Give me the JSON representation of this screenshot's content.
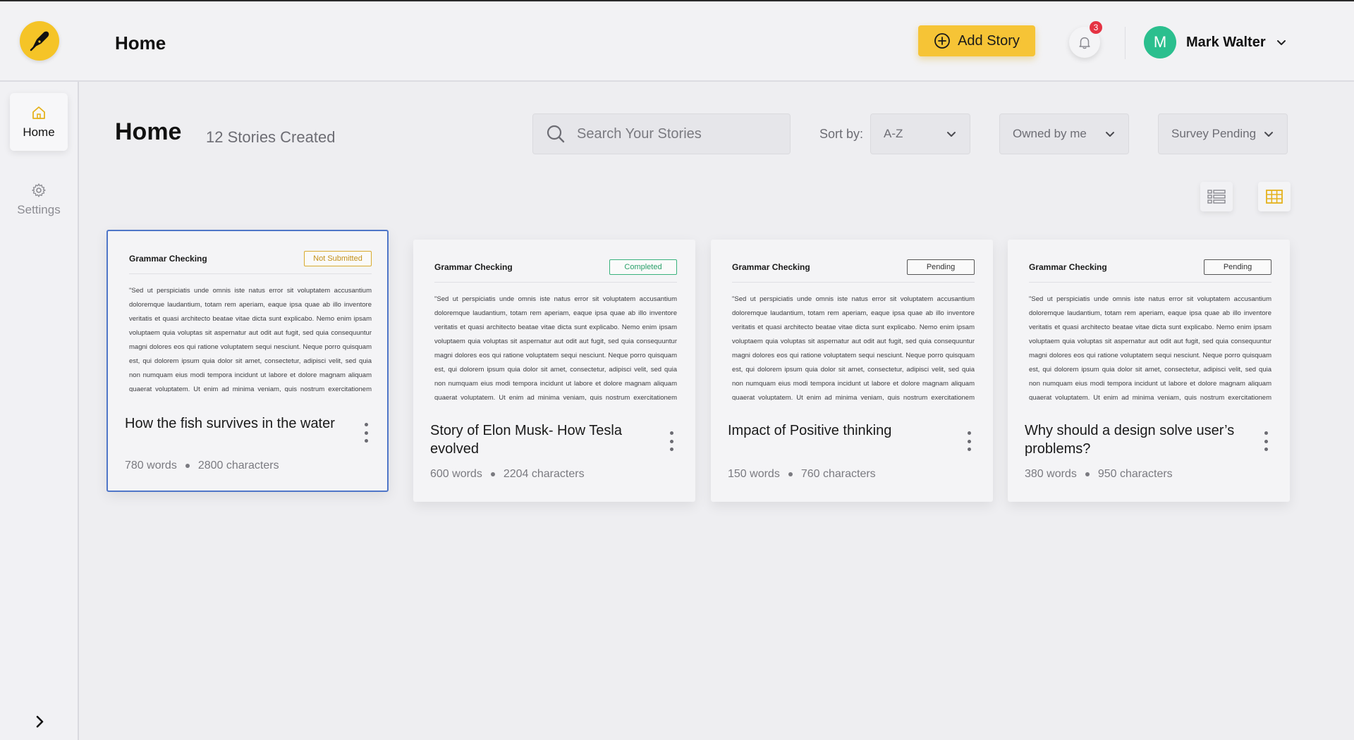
{
  "header": {
    "title": "Home",
    "add_story_label": "Add Story",
    "notification_count": "3",
    "user": {
      "initial": "M",
      "name": "Mark Walter"
    }
  },
  "sidebar": {
    "items": [
      {
        "label": "Home",
        "icon": "home-icon",
        "active": true
      },
      {
        "label": "Settings",
        "icon": "gear-icon",
        "active": false
      }
    ]
  },
  "main": {
    "title": "Home",
    "stories_count": "12 Stories Created",
    "search": {
      "placeholder": "Search Your Stories"
    },
    "sort_label": "Sort by:",
    "sort_value": "A-Z",
    "owner_filter": "Owned by me",
    "status_filter": "Survey Pending"
  },
  "colors": {
    "accent": "#f6c436",
    "selected_border": "#4f76c8",
    "completed": "#2aa06a",
    "not_submitted": "#c39017",
    "badge": "#e53343",
    "avatar": "#2bbf8e"
  },
  "stories": [
    {
      "doc_title": "Grammar Checking",
      "status": "Not Submitted",
      "body": "\"Sed ut perspiciatis unde omnis iste natus error sit voluptatem accusantium doloremque laudantium, totam rem aperiam, eaque ipsa quae ab illo inventore veritatis et quasi architecto beatae vitae dicta sunt explicabo. Nemo enim ipsam voluptaem quia voluptas sit aspernatur aut odit aut fugit, sed quia consequuntur magni dolores eos qui ratione voluptatem sequi nesciunt. Neque porro quisquam est, qui dolorem ipsum quia dolor sit amet, consectetur, adipisci velit, sed quia non numquam eius modi tempora incidunt ut labore et dolore magnam aliquam quaerat voluptatem. Ut enim ad minima veniam, quis nostrum exercitationem ullam",
      "title": "How the fish survives in the water",
      "words": "780 words",
      "characters": "2800 characters"
    },
    {
      "doc_title": "Grammar Checking",
      "status": "Completed",
      "body": "\"Sed ut perspiciatis unde omnis iste natus error sit voluptatem accusantium doloremque laudantium, totam rem aperiam, eaque ipsa quae ab illo inventore veritatis et quasi architecto beatae vitae dicta sunt explicabo. Nemo enim ipsam voluptaem quia voluptas sit aspernatur aut odit aut fugit, sed quia consequuntur magni dolores eos qui ratione voluptatem sequi nesciunt. Neque porro quisquam est, qui dolorem ipsum quia dolor sit amet, consectetur, adipisci velit, sed quia non numquam eius modi tempora incidunt ut labore et dolore magnam aliquam quaerat voluptatem. Ut enim ad minima veniam, quis nostrum exercitationem ullam",
      "title": "Story of Elon Musk- How Tesla evolved",
      "words": "600 words",
      "characters": "2204 characters"
    },
    {
      "doc_title": "Grammar Checking",
      "status": "Pending",
      "body": "\"Sed ut perspiciatis unde omnis iste natus error sit voluptatem accusantium doloremque laudantium, totam rem aperiam, eaque ipsa quae ab illo inventore veritatis et quasi architecto beatae vitae dicta sunt explicabo. Nemo enim ipsam voluptaem quia voluptas sit aspernatur aut odit aut fugit, sed quia consequuntur magni dolores eos qui ratione voluptatem sequi nesciunt. Neque porro quisquam est, qui dolorem ipsum quia dolor sit amet, consectetur, adipisci velit, sed quia non numquam eius modi tempora incidunt ut labore et dolore magnam aliquam quaerat voluptatem. Ut enim ad minima veniam, quis nostrum exercitationem ullam",
      "title": "Impact of Positive thinking",
      "words": "150 words",
      "characters": "760 characters"
    },
    {
      "doc_title": "Grammar Checking",
      "status": "Pending",
      "body": "\"Sed ut perspiciatis unde omnis iste natus error sit voluptatem accusantium doloremque laudantium, totam rem aperiam, eaque ipsa quae ab illo inventore veritatis et quasi architecto beatae vitae dicta sunt explicabo. Nemo enim ipsam voluptaem quia voluptas sit aspernatur aut odit aut fugit, sed quia consequuntur magni dolores eos qui ratione voluptatem sequi nesciunt. Neque porro quisquam est, qui dolorem ipsum quia dolor sit amet, consectetur, adipisci velit, sed quia non numquam eius modi tempora incidunt ut labore et dolore magnam aliquam quaerat voluptatem. Ut enim ad minima veniam, quis nostrum exercitationem ullam",
      "title": "Why should a design solve user’s problems?",
      "words": "380 words",
      "characters": "950 characters"
    }
  ]
}
